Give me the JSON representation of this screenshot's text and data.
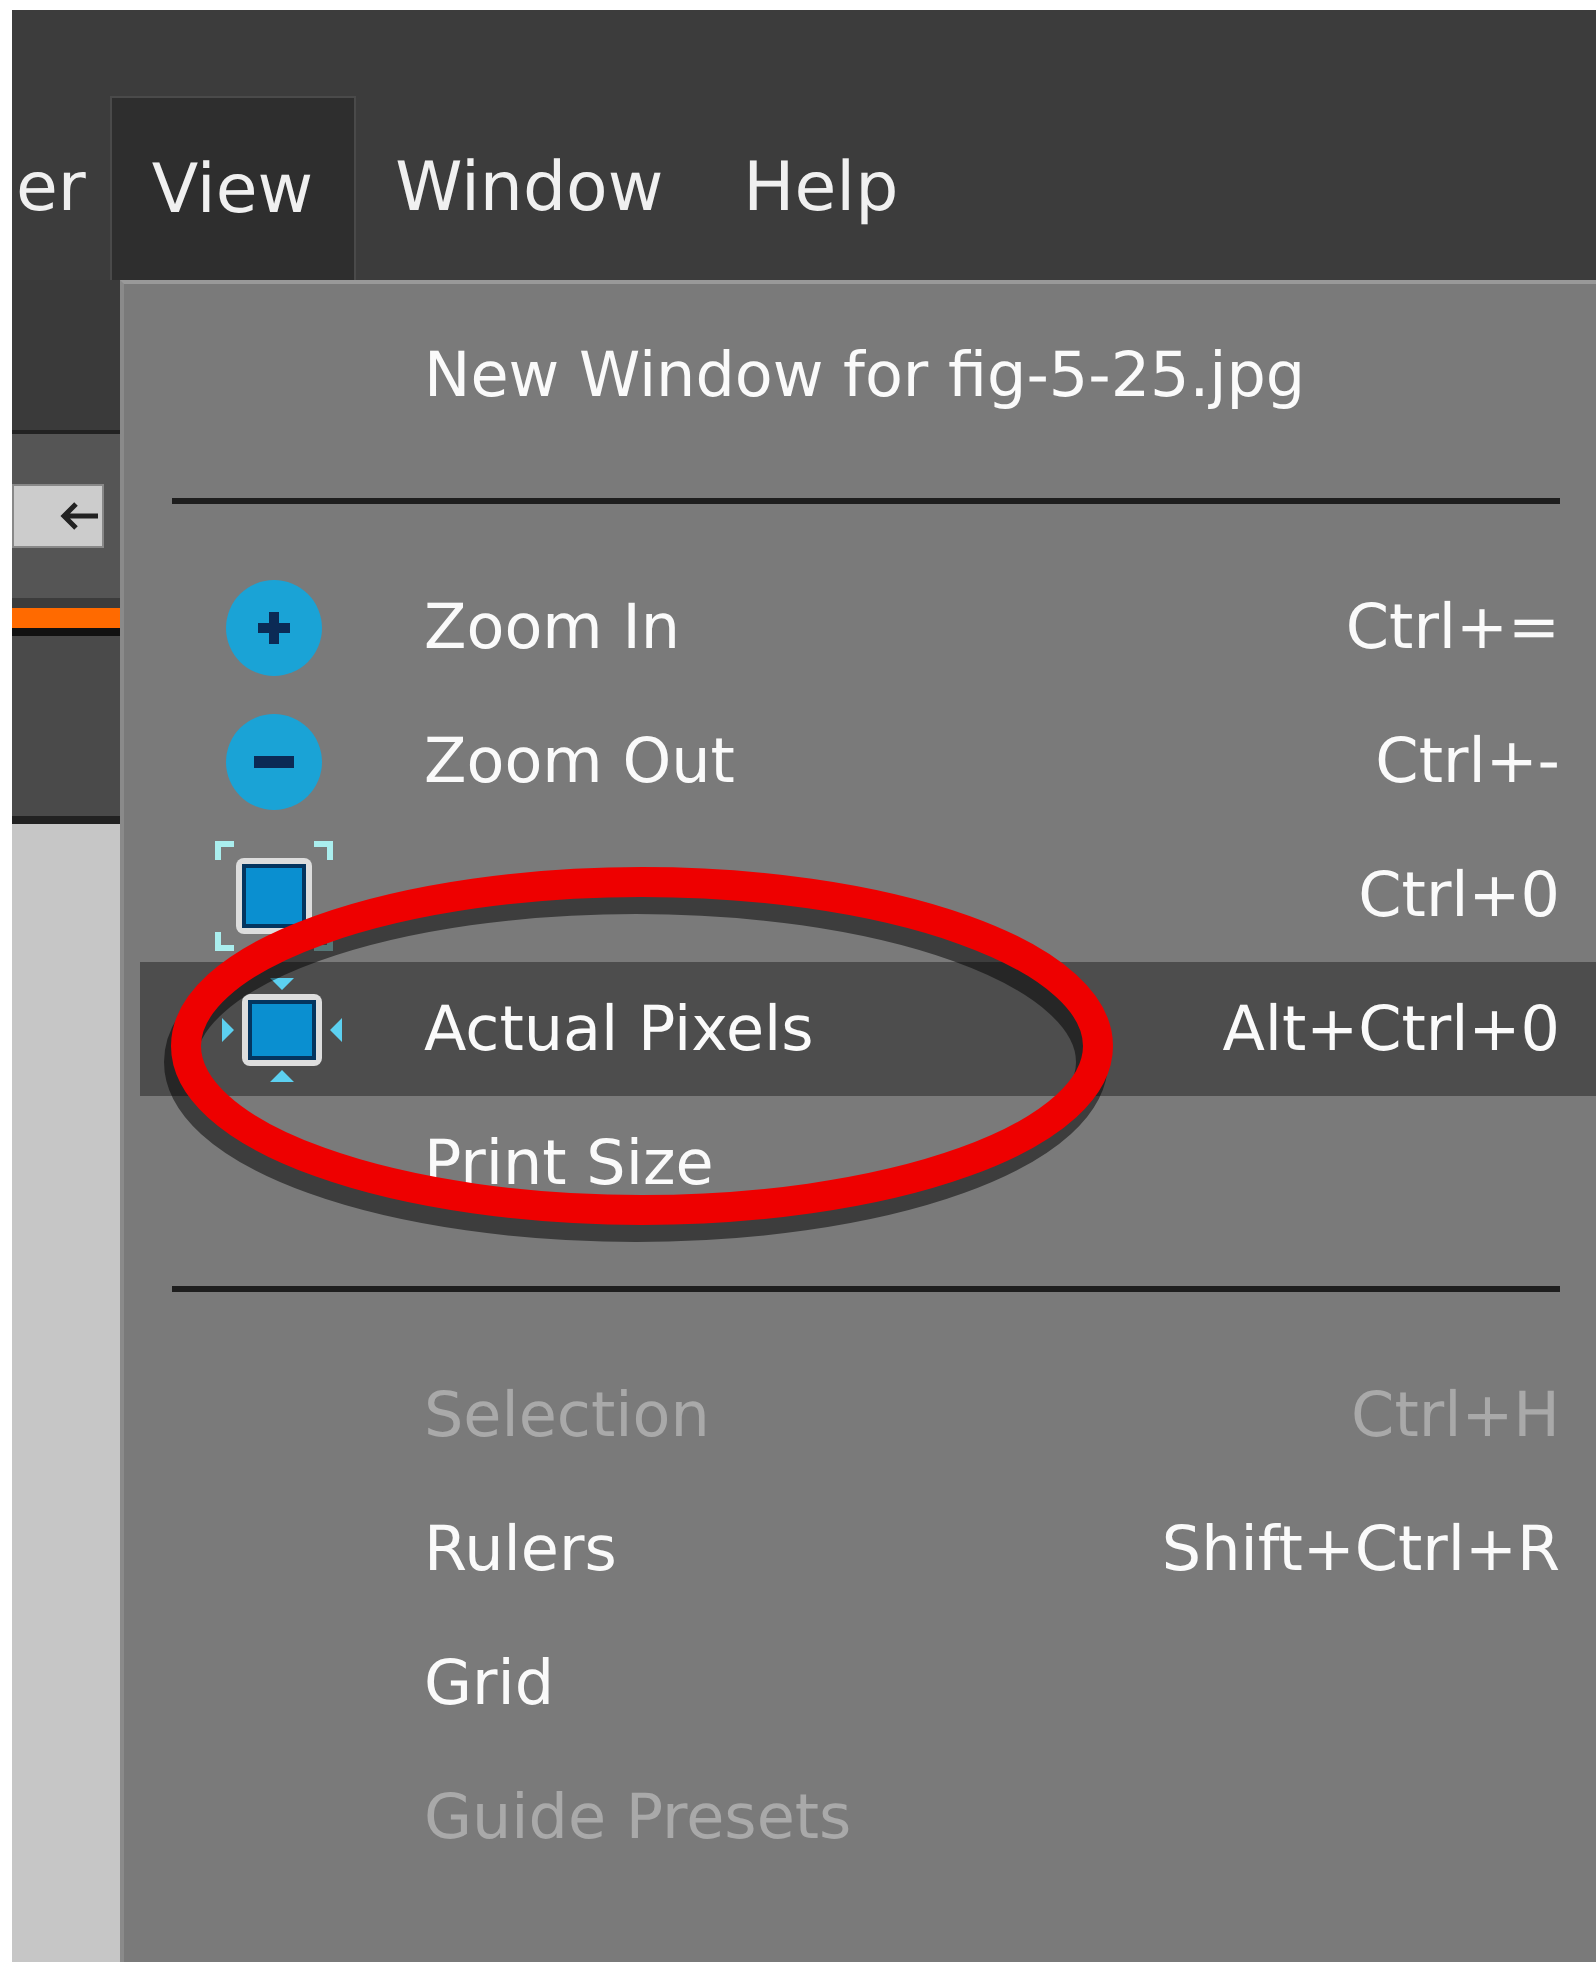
{
  "menu_bar": [
    {
      "label": "er",
      "selected": false
    },
    {
      "label": "View",
      "selected": true
    },
    {
      "label": "Window",
      "selected": false
    },
    {
      "label": "Help",
      "selected": false
    }
  ],
  "menu": {
    "items": [
      {
        "kind": "item",
        "label": "New Window for fig-5-25.jpg",
        "disabled": false,
        "selected": false
      },
      {
        "kind": "separator"
      },
      {
        "kind": "item",
        "label": "Zoom In",
        "shortcut": "Ctrl+=",
        "disabled": false,
        "selected": false
      },
      {
        "kind": "item",
        "label": "Zoom Out",
        "shortcut": "Ctrl+-",
        "disabled": false,
        "selected": false
      },
      {
        "kind": "item",
        "shortcut": "Ctrl+0",
        "disabled": false,
        "selected": false
      },
      {
        "kind": "item",
        "label": "Actual Pixels",
        "shortcut": "Alt+Ctrl+0",
        "disabled": false,
        "selected": true
      },
      {
        "kind": "item",
        "label": "Print Size",
        "disabled": false,
        "selected": false
      },
      {
        "kind": "separator"
      },
      {
        "kind": "item",
        "label": "Selection",
        "shortcut": "Ctrl+H",
        "disabled": true,
        "selected": false
      },
      {
        "kind": "item",
        "label": "Rulers",
        "shortcut": "Shift+Ctrl+R",
        "disabled": false,
        "selected": false
      },
      {
        "kind": "item",
        "label": "Grid",
        "disabled": false,
        "selected": false
      },
      {
        "kind": "item",
        "label": "Guide Presets",
        "disabled": true,
        "selected": false
      }
    ]
  }
}
